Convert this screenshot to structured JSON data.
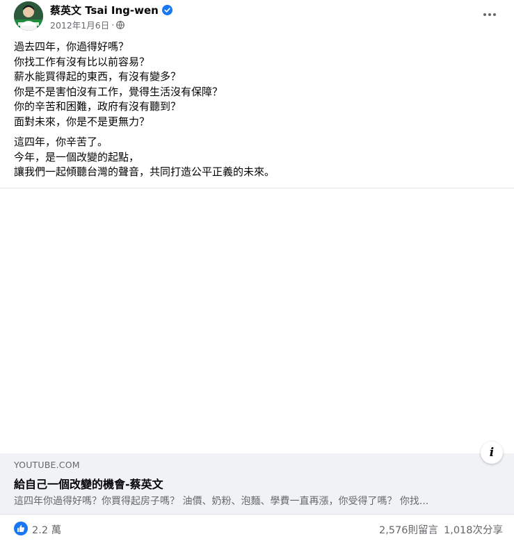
{
  "post": {
    "author": "蔡英文 Tsai Ing-wen",
    "date": "2012年1月6日",
    "separator": "·",
    "icons": {
      "verified": "verified-badge-icon",
      "audience": "globe-icon",
      "more": "more-options-icon"
    },
    "lines_paragraph1": [
      "過去四年，你過得好嗎？",
      "你找工作有沒有比以前容易？",
      "薪水能買得起的東西，有沒有變多？",
      "你是不是害怕沒有工作，覺得生活沒有保障？",
      "你的辛苦和困難，政府有沒有聽到？",
      "面對未來，你是不是更無力？"
    ],
    "lines_paragraph2": [
      "這四年，你辛苦了。",
      "今年，是一個改變的起點，",
      "讓我們一起傾聽台灣的聲音，共同打造公平正義的未來。"
    ]
  },
  "link_preview": {
    "domain": "YOUTUBE.COM",
    "title": "給自己一個改變的機會-蔡英文",
    "description": "這四年你過得好嗎？你買得起房子嗎？ 油價、奶粉、泡麵、學費一直再漲，你受得了嗎？ 你找..."
  },
  "footer": {
    "likes": "2.2 萬",
    "comments": "2,576則留言",
    "shares": "1,018次分享"
  },
  "colors": {
    "accent": "#1877f2",
    "secondary_text": "#65676b",
    "card_bg": "#f0f2f5"
  }
}
